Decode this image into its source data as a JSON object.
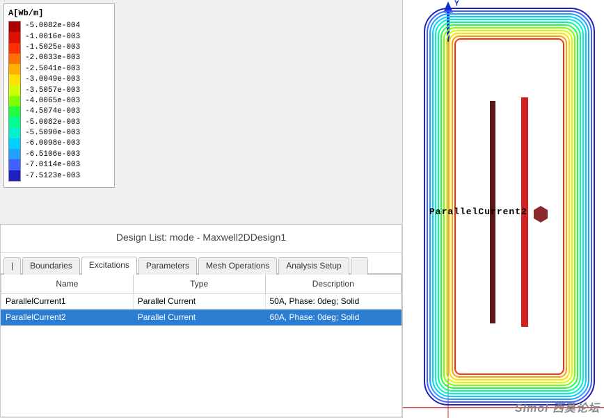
{
  "legend": {
    "title": "A[Wb/m]",
    "entries": [
      {
        "color": "#b00000",
        "label": "-5.0082e-004"
      },
      {
        "color": "#e01000",
        "label": "-1.0016e-003"
      },
      {
        "color": "#ff3000",
        "label": "-1.5025e-003"
      },
      {
        "color": "#ff7000",
        "label": "-2.0033e-003"
      },
      {
        "color": "#ffb000",
        "label": "-2.5041e-003"
      },
      {
        "color": "#ffe000",
        "label": "-3.0049e-003"
      },
      {
        "color": "#d0ff00",
        "label": "-3.5057e-003"
      },
      {
        "color": "#80ff00",
        "label": "-4.0065e-003"
      },
      {
        "color": "#20ff40",
        "label": "-4.5074e-003"
      },
      {
        "color": "#00ff90",
        "label": "-5.0082e-003"
      },
      {
        "color": "#00f0d0",
        "label": "-5.5090e-003"
      },
      {
        "color": "#00d0ff",
        "label": "-6.0098e-003"
      },
      {
        "color": "#20a0ff",
        "label": "-6.5106e-003"
      },
      {
        "color": "#4060ff",
        "label": "-7.0114e-003"
      },
      {
        "color": "#2020c0",
        "label": "-7.5123e-003"
      }
    ]
  },
  "design_list": {
    "title": "Design List: mode - Maxwell2DDesign1",
    "tabs": [
      "|",
      "Boundaries",
      "Excitations",
      "Parameters",
      "Mesh Operations",
      "Analysis Setup",
      ""
    ],
    "active_tab_index": 2,
    "columns": [
      "Name",
      "Type",
      "Description"
    ],
    "rows": [
      {
        "name": "ParallelCurrent1",
        "type": "Parallel Current",
        "desc": "50A, Phase: 0deg; Solid",
        "selected": false
      },
      {
        "name": "ParallelCurrent2",
        "type": "Parallel Current",
        "desc": "60A, Phase: 0deg; Solid",
        "selected": true
      }
    ]
  },
  "plot": {
    "y_axis_label": "Y",
    "annotation": "Par|lle|Current2",
    "annotation_display": "ParallelCurrent2",
    "watermark": "Simol 西莫论坛"
  }
}
